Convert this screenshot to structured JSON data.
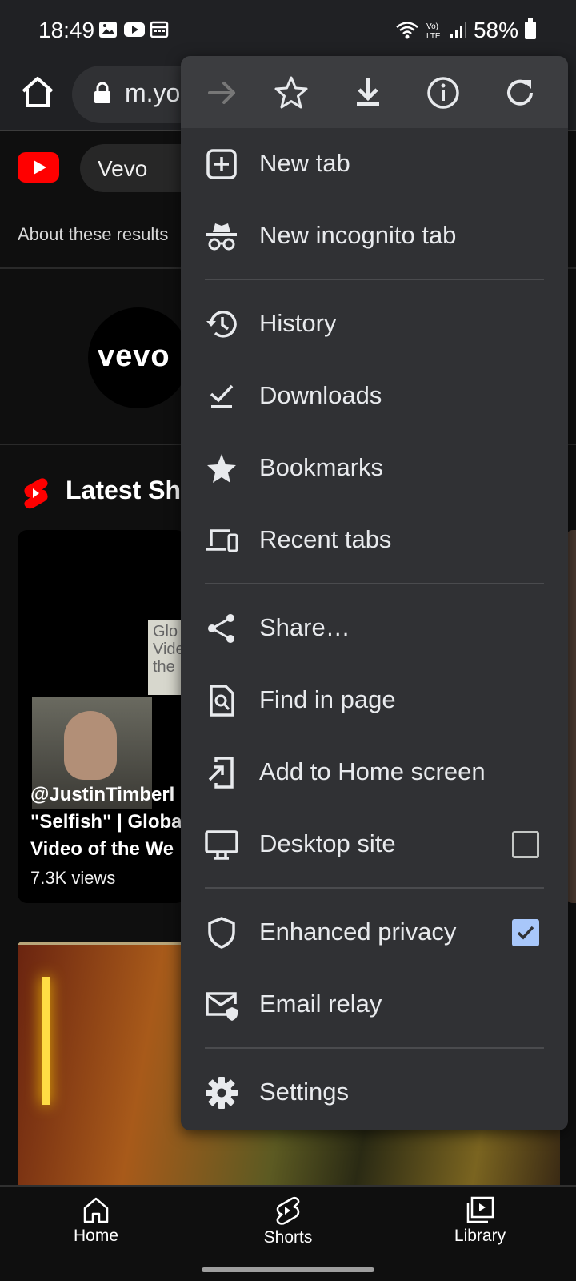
{
  "status_bar": {
    "time": "18:49",
    "battery": "58%"
  },
  "browser": {
    "url": "m.yo"
  },
  "page": {
    "chip_label": "Vevo",
    "about_text": "About these results",
    "vevo_avatar_text": "vevo",
    "shorts_heading": "Latest Sh",
    "short_card": {
      "sign_text": "Glo\nVide\nthe",
      "title": "@JustinTimberl\n\"Selfish\" | Globa\nVideo of the We",
      "views": "7.3K views"
    }
  },
  "bottom_nav": [
    {
      "label": "Home"
    },
    {
      "label": "Shorts"
    },
    {
      "label": "Library"
    }
  ],
  "menu": {
    "top_icons": [
      "forward-icon",
      "bookmark-star-icon",
      "download-icon",
      "info-icon",
      "refresh-icon"
    ],
    "items": [
      {
        "label": "New tab",
        "icon": "new-tab-icon"
      },
      {
        "label": "New incognito tab",
        "icon": "incognito-icon"
      },
      {
        "label": "History",
        "icon": "history-icon"
      },
      {
        "label": "Downloads",
        "icon": "downloads-icon"
      },
      {
        "label": "Bookmarks",
        "icon": "bookmarks-star-icon"
      },
      {
        "label": "Recent tabs",
        "icon": "recent-tabs-icon"
      },
      {
        "label": "Share…",
        "icon": "share-icon"
      },
      {
        "label": "Find in page",
        "icon": "find-in-page-icon"
      },
      {
        "label": "Add to Home screen",
        "icon": "add-to-home-icon"
      },
      {
        "label": "Desktop site",
        "icon": "desktop-icon",
        "checked": false
      },
      {
        "label": "Enhanced privacy",
        "icon": "shield-icon",
        "checked": true
      },
      {
        "label": "Email relay",
        "icon": "email-relay-icon"
      },
      {
        "label": "Settings",
        "icon": "settings-gear-icon"
      }
    ]
  },
  "colors": {
    "menu_bg": "#303134",
    "menu_top_bg": "#3c3d40",
    "checkbox_checked": "#a8c7fa",
    "youtube_red": "#ff0000"
  }
}
